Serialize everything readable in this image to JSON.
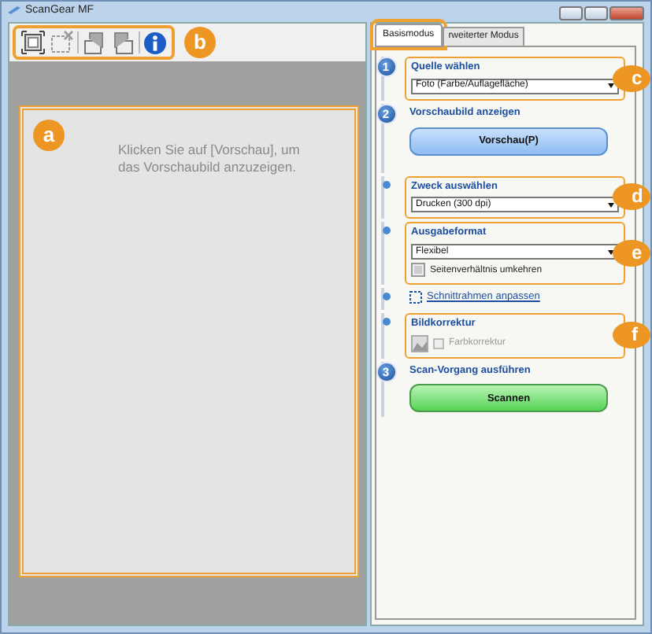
{
  "window": {
    "title": "ScanGear MF"
  },
  "toolbar": {
    "callout": "b"
  },
  "preview": {
    "message": "Klicken Sie auf [Vorschau], um das Vorschaubild anzuzeigen.",
    "callout": "a"
  },
  "tabs": [
    {
      "label": "Basismodus",
      "selected": true
    },
    {
      "label": "rweiterter Modus",
      "selected": false
    }
  ],
  "tab_callout": true,
  "steps": [
    {
      "kind": "dropdown",
      "number": "1",
      "label": "Quelle wählen",
      "value": "Foto (Farbe/Auflagefläche)",
      "callout": "c"
    },
    {
      "kind": "button",
      "number": "2",
      "label": "Vorschaubild anzeigen",
      "button": "Vorschau(P)"
    },
    {
      "kind": "dropdown",
      "label": "Zweck auswählen",
      "value": "Drucken (300 dpi)",
      "callout": "d"
    },
    {
      "kind": "format",
      "label": "Ausgabeformat",
      "value": "Flexibel",
      "option": "Seitenverhältnis umkehren",
      "callout": "e"
    },
    {
      "kind": "link",
      "label": "Schnittrahmen anpassen"
    },
    {
      "kind": "correction",
      "label": "Bildkorrektur",
      "option": "Farbkorrektur",
      "checked": false,
      "disabled": true,
      "callout": "f"
    },
    {
      "kind": "scan",
      "number": "3",
      "label": "Scan-Vorgang ausführen",
      "button": "Scannen"
    }
  ]
}
